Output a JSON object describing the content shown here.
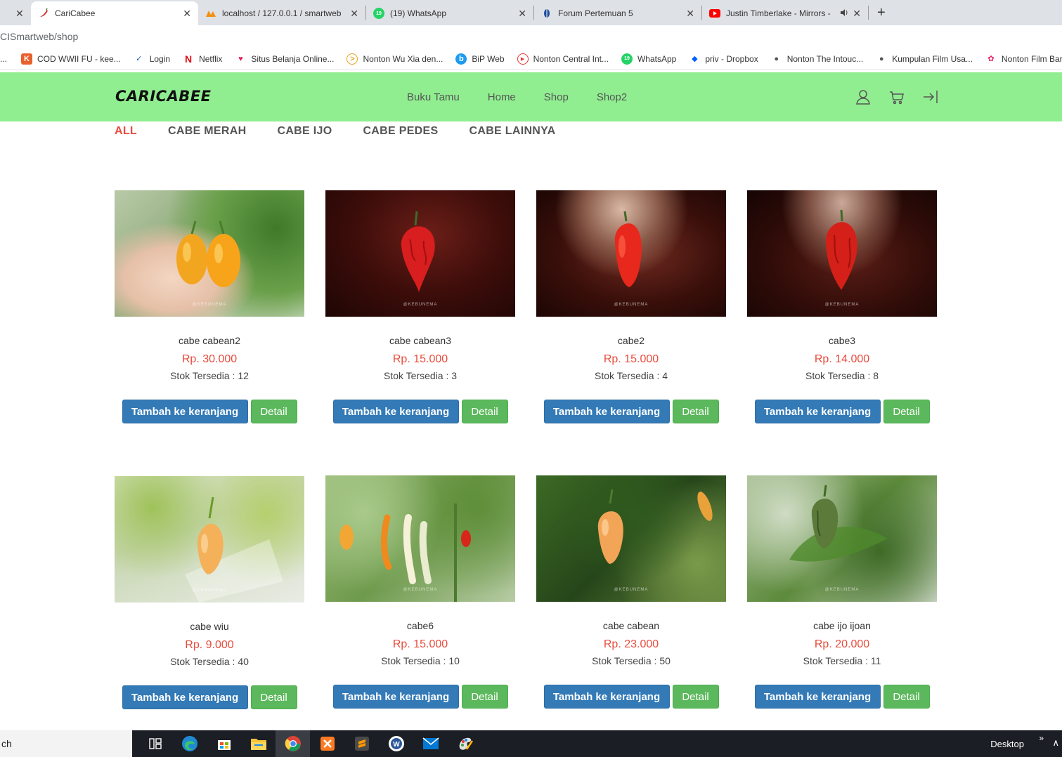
{
  "browser": {
    "tabs": [
      {
        "title": "",
        "close": "✕"
      },
      {
        "title": "CariCabee",
        "close": "✕",
        "icon": "chili-favicon-icon"
      },
      {
        "title": "localhost / 127.0.0.1 / smartweb",
        "close": "✕",
        "icon": "phpmyadmin-icon"
      },
      {
        "title": "(19) WhatsApp",
        "close": "✕",
        "icon": "whatsapp-icon"
      },
      {
        "title": "Forum Pertemuan 5",
        "close": "✕",
        "icon": "forum-icon"
      },
      {
        "title": "Justin Timberlake - Mirrors -",
        "close": "✕",
        "icon": "youtube-icon"
      }
    ],
    "whatsapp_badge": "19",
    "new_tab": "+",
    "address": "CISmartweb/shop",
    "bookmarks": [
      {
        "label": "...",
        "icon": ""
      },
      {
        "label": "COD WWII FU - kee...",
        "icon": "K"
      },
      {
        "label": "Login",
        "icon": "✓"
      },
      {
        "label": "Netflix",
        "icon": "N"
      },
      {
        "label": "Situs Belanja Online...",
        "icon": "♥"
      },
      {
        "label": "Nonton Wu Xia den...",
        "icon": ">"
      },
      {
        "label": "BiP Web",
        "icon": "b"
      },
      {
        "label": "Nonton Central Int...",
        "icon": "▶"
      },
      {
        "label": "WhatsApp",
        "icon": "19"
      },
      {
        "label": "priv - Dropbox",
        "icon": "◆"
      },
      {
        "label": "Nonton The Intouc...",
        "icon": "●"
      },
      {
        "label": "Kumpulan Film Usa...",
        "icon": "●"
      },
      {
        "label": "Nonton Film Baru",
        "icon": "✿"
      }
    ]
  },
  "site": {
    "logo": "CARICABEE",
    "nav": [
      "Buku Tamu",
      "Home",
      "Shop",
      "Shop2"
    ],
    "filters": [
      "ALL",
      "CABE MERAH",
      "CABE IJO",
      "CABE PEDES",
      "CABE LAINNYA"
    ],
    "active_filter": "ALL",
    "cart_button_label": "Tambah ke keranjang",
    "detail_button_label": "Detail",
    "watermark": "@KEBUNEMA",
    "products": [
      {
        "name": "cabe cabean2",
        "price": "Rp. 30.000",
        "stock": "Stok Tersedia : 12",
        "image": "orange-habanero-in-hand"
      },
      {
        "name": "cabe cabean3",
        "price": "Rp. 15.000",
        "stock": "Stok Tersedia : 3",
        "image": "red-reaper-dark-bg"
      },
      {
        "name": "cabe2",
        "price": "Rp. 15.000",
        "stock": "Stok Tersedia : 4",
        "image": "red-pepper-dark-bg"
      },
      {
        "name": "cabe3",
        "price": "Rp. 14.000",
        "stock": "Stok Tersedia : 8",
        "image": "red-reaper-dark-bg-2"
      },
      {
        "name": "cabe wiu",
        "price": "Rp. 9.000",
        "stock": "Stok Tersedia : 40",
        "image": "orange-pepper-on-plant"
      },
      {
        "name": "cabe6",
        "price": "Rp. 15.000",
        "stock": "Stok Tersedia : 10",
        "image": "mixed-peppers-on-plant"
      },
      {
        "name": "cabe cabean",
        "price": "Rp. 23.000",
        "stock": "Stok Tersedia : 50",
        "image": "orange-pepper-green-leaves"
      },
      {
        "name": "cabe ijo ijoan",
        "price": "Rp. 20.000",
        "stock": "Stok Tersedia : 11",
        "image": "green-pepper-on-plant"
      }
    ]
  },
  "taskbar": {
    "search": "ch",
    "desktop_label": "Desktop",
    "chevron": "»",
    "up_arrow": "∧"
  },
  "colors": {
    "header_bg": "#90ee90",
    "accent_red": "#e74c3c",
    "cart_blue": "#337ab7",
    "detail_green": "#5cb85c"
  }
}
